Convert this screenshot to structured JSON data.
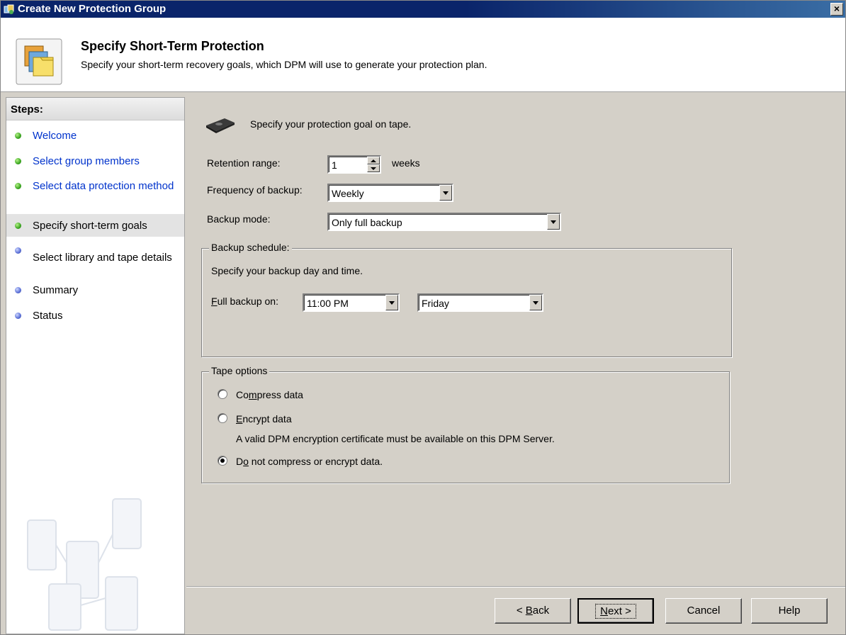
{
  "window": {
    "title": "Create New Protection Group",
    "close_glyph": "×"
  },
  "header": {
    "title": "Specify Short-Term Protection",
    "description": "Specify your short-term recovery goals, which DPM will use to generate your protection plan.",
    "icon": "protection-group-icon"
  },
  "sidebar": {
    "heading": "Steps:",
    "items": [
      {
        "label": "Welcome",
        "state": "link",
        "dot": "green"
      },
      {
        "label": "Select group members",
        "state": "link",
        "dot": "green"
      },
      {
        "label": "Select data protection method",
        "state": "link",
        "dot": "green"
      },
      {
        "label": "Specify short-term goals",
        "state": "active",
        "dot": "green"
      },
      {
        "label": "Select library and tape details",
        "state": "pending",
        "dot": "blue"
      },
      {
        "label": "Summary",
        "state": "pending",
        "dot": "blue"
      },
      {
        "label": "Status",
        "state": "pending",
        "dot": "blue"
      }
    ]
  },
  "main": {
    "title": "Specify your protection goal on tape.",
    "retention": {
      "label": "Retention range:",
      "value": "1",
      "unit": "weeks"
    },
    "frequency": {
      "label": "Frequency of backup:",
      "value": "Weekly"
    },
    "backup_mode": {
      "label": "Backup mode:",
      "value": "Only full backup"
    },
    "schedule": {
      "legend": "Backup schedule:",
      "description": "Specify your backup day and time.",
      "full_backup_label_accel": "F",
      "full_backup_label_rest": "ull backup on:",
      "time_value": "11:00 PM",
      "day_value": "Friday"
    },
    "tape_options": {
      "legend": "Tape options",
      "compress": {
        "pre": "Co",
        "accel": "m",
        "post": "press data",
        "checked": false
      },
      "encrypt": {
        "pre": "",
        "accel": "E",
        "post": "ncrypt data",
        "checked": false
      },
      "encrypt_note": "A valid DPM encryption certificate must be available on this DPM Server.",
      "none": {
        "pre": "D",
        "accel": "o",
        "post": " not compress or encrypt data.",
        "checked": true
      }
    }
  },
  "footer": {
    "back": {
      "pre": "< ",
      "accel": "B",
      "post": "ack"
    },
    "next": {
      "pre": "",
      "accel": "N",
      "post": "ext >"
    },
    "cancel": "Cancel",
    "help": "Help"
  }
}
